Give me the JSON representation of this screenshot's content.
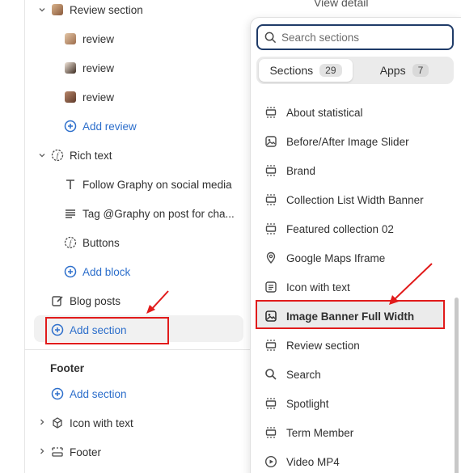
{
  "tree": {
    "review_section": {
      "label": "Review section",
      "items": [
        "review",
        "review",
        "review"
      ],
      "add_label": "Add review"
    },
    "rich_text": {
      "label": "Rich text",
      "items": [
        "Follow Graphy on social media",
        "Tag @Graphy on post for cha...",
        "Buttons"
      ],
      "add_label": "Add block"
    },
    "blog_posts": "Blog posts",
    "add_section": "Add section",
    "footer": {
      "heading": "Footer",
      "add_label": "Add section",
      "items": [
        "Icon with text",
        "Footer"
      ]
    }
  },
  "background_text": "View detail",
  "popover": {
    "search_placeholder": "Search sections",
    "tabs": [
      {
        "label": "Sections",
        "count": "29"
      },
      {
        "label": "Apps",
        "count": "7"
      }
    ],
    "sections": [
      {
        "label": "About statistical",
        "icon": "layout-rows-icon"
      },
      {
        "label": "Before/After Image Slider",
        "icon": "image-icon"
      },
      {
        "label": "Brand",
        "icon": "layout-rows-icon"
      },
      {
        "label": "Collection List Width Banner",
        "icon": "layout-rows-icon"
      },
      {
        "label": "Featured collection 02",
        "icon": "layout-rows-icon"
      },
      {
        "label": "Google Maps Iframe",
        "icon": "map-pin-icon"
      },
      {
        "label": "Icon with text",
        "icon": "text-block-icon"
      },
      {
        "label": "Image Banner Full Width",
        "icon": "image-icon"
      },
      {
        "label": "Review section",
        "icon": "layout-rows-icon"
      },
      {
        "label": "Search",
        "icon": "search-icon"
      },
      {
        "label": "Spotlight",
        "icon": "layout-rows-icon"
      },
      {
        "label": "Term Member",
        "icon": "layout-rows-icon"
      },
      {
        "label": "Video MP4",
        "icon": "play-icon"
      }
    ]
  },
  "colors": {
    "link": "#2c6ecb",
    "annotation_red": "#e11b1b",
    "search_border": "#1f3b68"
  }
}
